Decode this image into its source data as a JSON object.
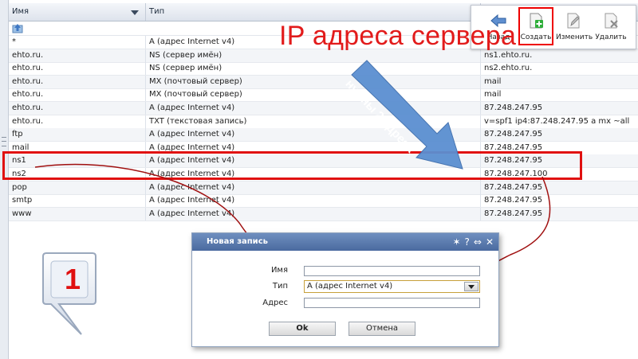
{
  "table": {
    "headers": {
      "name": "Имя",
      "type": "Тип"
    },
    "rows": [
      {
        "name": "*",
        "type": "A (адрес Internet v4)",
        "value": ""
      },
      {
        "name": "ehto.ru.",
        "type": "NS (сервер имён)",
        "value": "ns1.ehto.ru."
      },
      {
        "name": "ehto.ru.",
        "type": "NS (сервер имён)",
        "value": "ns2.ehto.ru."
      },
      {
        "name": "ehto.ru.",
        "type": "MX (почтовый сервер)",
        "value": "mail"
      },
      {
        "name": "ehto.ru.",
        "type": "MX (почтовый сервер)",
        "value": "mail"
      },
      {
        "name": "ehto.ru.",
        "type": "A (адрес Internet v4)",
        "value": "87.248.247.95"
      },
      {
        "name": "ehto.ru.",
        "type": "TXT (текстовая запись)",
        "value": "v=spf1 ip4:87.248.247.95 a mx ~all"
      },
      {
        "name": "ftp",
        "type": "A (адрес Internet v4)",
        "value": "87.248.247.95"
      },
      {
        "name": "mail",
        "type": "A (адрес Internet v4)",
        "value": "87.248.247.95"
      },
      {
        "name": "ns1",
        "type": "A (адрес Internet v4)",
        "value": "87.248.247.95"
      },
      {
        "name": "ns2",
        "type": "A (адрес Internet v4)",
        "value": "87.248.247.100"
      },
      {
        "name": "pop",
        "type": "A (адрес Internet v4)",
        "value": "87.248.247.95"
      },
      {
        "name": "smtp",
        "type": "A (адрес Internet v4)",
        "value": "87.248.247.95"
      },
      {
        "name": "www",
        "type": "A (адрес Internet v4)",
        "value": "87.248.247.95"
      }
    ]
  },
  "toolbar": {
    "back": "Назад",
    "create": "Создать",
    "edit": "Изменить",
    "delete": "Удалить"
  },
  "annotations": {
    "title": "IP адреса сервера",
    "arrow_label": "нужны 2 адреса",
    "callout_number": "1"
  },
  "dialog": {
    "title": "Новая запись",
    "name_label": "Имя",
    "name_value": "",
    "type_label": "Тип",
    "type_value": "A (адрес Internet v4)",
    "address_label": "Адрес",
    "address_value": "",
    "ok": "Ok",
    "cancel": "Отмена"
  },
  "colors": {
    "annotation_red": "#e21b1b",
    "arrow_blue": "#4f86c6",
    "dialog_header": "#5677ab",
    "arrow_dark_red": "#a01010"
  }
}
